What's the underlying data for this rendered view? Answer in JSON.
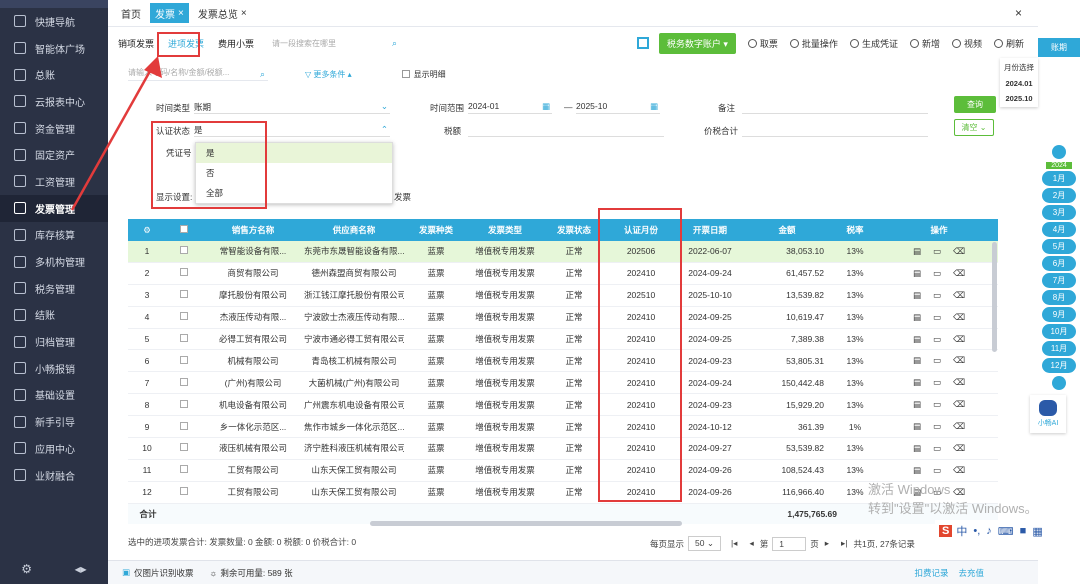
{
  "sidebar": {
    "items": [
      "快捷导航",
      "智能体广场",
      "总账",
      "云报表中心",
      "资金管理",
      "固定资产",
      "工资管理",
      "发票管理",
      "库存核算",
      "多机构管理",
      "税务管理",
      "结账",
      "归档管理",
      "小畅报销",
      "基础设置",
      "新手引导",
      "应用中心",
      "业财融合"
    ],
    "active_index": 7,
    "collapse_icon": "◂▸"
  },
  "topbar": {
    "tabs": [
      {
        "label": "首页",
        "active": false
      },
      {
        "label": "发票",
        "active": true
      },
      {
        "label": "发票总览",
        "active": false
      }
    ],
    "close": "×"
  },
  "toolbar": {
    "subtabs": [
      "销项发票",
      "进项发票",
      "费用小票"
    ],
    "search_placeholder": "请一段搜索在哪里",
    "account_btn": "税务数字账户",
    "buttons": [
      "取票",
      "批量操作",
      "生成凭证",
      "新增",
      "视频",
      "刷新"
    ]
  },
  "filter": {
    "placeholder": "请输入号码/名称/金额/税额...",
    "more": "更多条件",
    "show_detail": "显示明细"
  },
  "panel": {
    "time_type_label": "时间类型",
    "time_type": "账期",
    "time_range_label": "时间范围",
    "date_from": "2024-01",
    "date_sep": "—",
    "date_to": "2025-10",
    "remark_label": "备注",
    "query_btn": "查询",
    "clear_btn": "清空",
    "auth_label": "认证状态",
    "auth_value": "是",
    "tax_label": "税额",
    "total_label": "价税合计",
    "voucher_label": "凭证号",
    "display_label": "显示设置:",
    "invoice_text": "发票",
    "options": [
      "是",
      "否",
      "全部"
    ]
  },
  "table": {
    "headers": [
      "",
      "",
      "销售方名称",
      "供应商名称",
      "发票种类",
      "发票类型",
      "发票状态",
      "认证月份",
      "开票日期",
      "金额",
      "税率",
      "操作"
    ],
    "rows": [
      [
        "1",
        "",
        "常智能设备有限...",
        "东莞市东晟智能设备有限...",
        "蓝票",
        "增值税专用发票",
        "正常",
        "202506",
        "2022-06-07",
        "38,053.10",
        "13%"
      ],
      [
        "2",
        "",
        "商贸有限公司",
        "德州森盟商贸有限公司",
        "蓝票",
        "增值税专用发票",
        "正常",
        "202410",
        "2024-09-24",
        "61,457.52",
        "13%"
      ],
      [
        "3",
        "",
        "摩托股份有限公司",
        "浙江钱江摩托股份有限公司",
        "蓝票",
        "增值税专用发票",
        "正常",
        "202510",
        "2025-10-10",
        "13,539.82",
        "13%"
      ],
      [
        "4",
        "",
        "杰液压传动有限...",
        "宁波欧士杰液压传动有限...",
        "蓝票",
        "增值税专用发票",
        "正常",
        "202410",
        "2024-09-25",
        "10,619.47",
        "13%"
      ],
      [
        "5",
        "",
        "必得工贸有限公司",
        "宁波市通必得工贸有限公司",
        "蓝票",
        "增值税专用发票",
        "正常",
        "202410",
        "2024-09-25",
        "7,389.38",
        "13%"
      ],
      [
        "6",
        "",
        "机械有限公司",
        "青岛核工机械有限公司",
        "蓝票",
        "增值税专用发票",
        "正常",
        "202410",
        "2024-09-23",
        "53,805.31",
        "13%"
      ],
      [
        "7",
        "",
        "(广州)有限公司",
        "大菌机械(广州)有限公司",
        "蓝票",
        "增值税专用发票",
        "正常",
        "202410",
        "2024-09-24",
        "150,442.48",
        "13%"
      ],
      [
        "8",
        "",
        "机电设备有限公司",
        "广州震东机电设备有限公司",
        "蓝票",
        "增值税专用发票",
        "正常",
        "202410",
        "2024-09-23",
        "15,929.20",
        "13%"
      ],
      [
        "9",
        "",
        "乡一体化示范区...",
        "焦作市城乡一体化示范区...",
        "蓝票",
        "增值税专用发票",
        "正常",
        "202410",
        "2024-10-12",
        "361.39",
        "1%"
      ],
      [
        "10",
        "",
        "液压机械有限公司",
        "济宁胜科液压机械有限公司",
        "蓝票",
        "增值税专用发票",
        "正常",
        "202410",
        "2024-09-27",
        "53,539.82",
        "13%"
      ],
      [
        "11",
        "",
        "工贸有限公司",
        "山东天保工贸有限公司",
        "蓝票",
        "增值税专用发票",
        "正常",
        "202410",
        "2024-09-26",
        "108,524.43",
        "13%"
      ],
      [
        "12",
        "",
        "工贸有限公司",
        "山东天保工贸有限公司",
        "蓝票",
        "增值税专用发票",
        "正常",
        "202410",
        "2024-09-26",
        "116,966.40",
        "13%"
      ]
    ],
    "footer_label": "合计",
    "footer_total": "1,475,765.69"
  },
  "status": {
    "text": "选中的进项发票合计: 发票数量: 0 金额: 0 税额: 0 价税合计: 0"
  },
  "pager": {
    "per_page_label": "每页显示",
    "per_page": "50",
    "page_label": "第",
    "page": "1",
    "page_unit": "页",
    "summary": "共1页, 27条记录"
  },
  "bottom": {
    "ocr": "仅图片识别收票",
    "remain": "剩余可用量: 589 张",
    "records": "扣费记录",
    "recharge": "去充值"
  },
  "right": {
    "head": "账期",
    "pop_title": "月份选择",
    "pop_from": "2024.01",
    "pop_to": "2025.10",
    "year": "2024",
    "months": [
      "1月",
      "2月",
      "3月",
      "4月",
      "5月",
      "6月",
      "7月",
      "8月",
      "9月",
      "10月",
      "11月",
      "12月"
    ],
    "agent": "小畅AI"
  },
  "watermark": {
    "line1": "激活 Windows",
    "line2": "转到\"设置\"以激活 Windows。"
  },
  "ime": {
    "label": "中"
  }
}
